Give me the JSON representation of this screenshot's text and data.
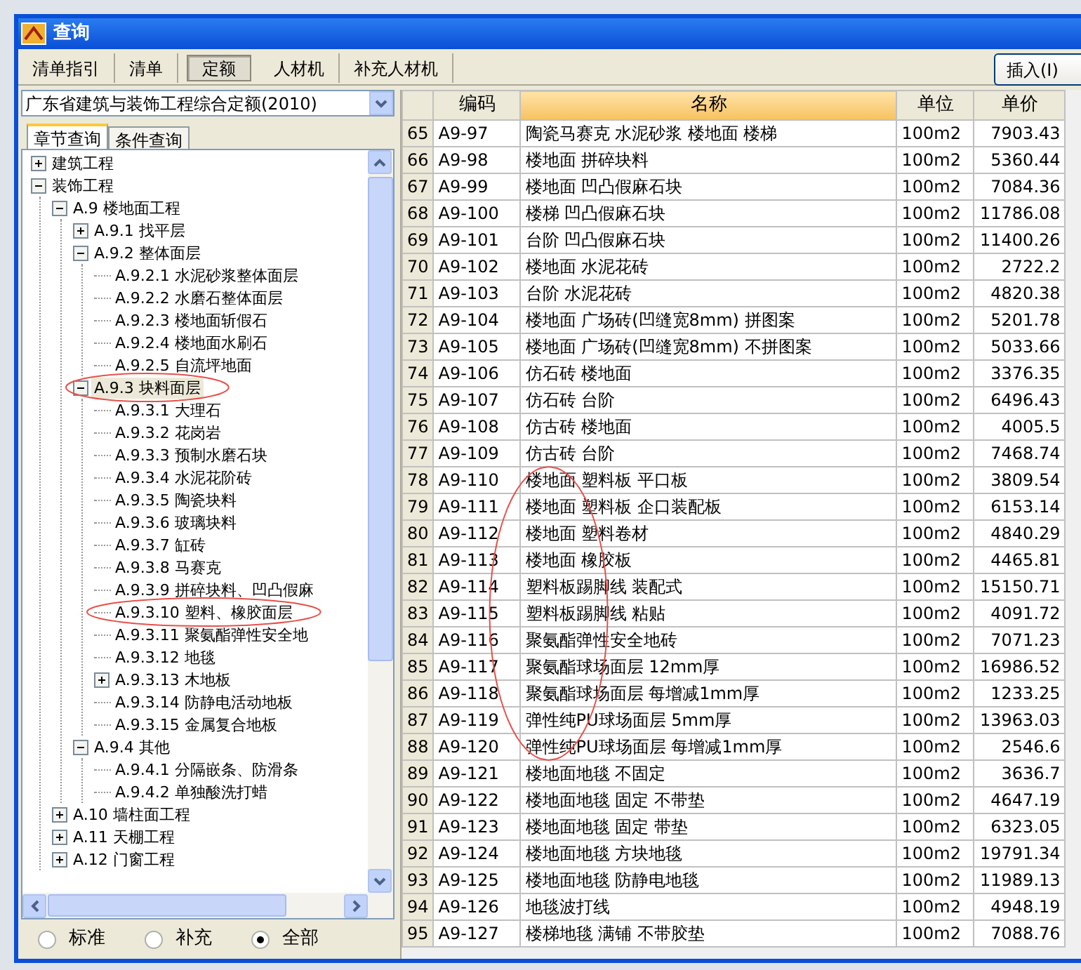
{
  "window": {
    "title": "查询"
  },
  "tabs": [
    {
      "label": "清单指引",
      "selected": false
    },
    {
      "label": "清单",
      "selected": false
    },
    {
      "label": "定额",
      "selected": true
    },
    {
      "label": "人材机",
      "selected": false
    },
    {
      "label": "补充人材机",
      "selected": false
    }
  ],
  "insert_button": "插入(I)",
  "quota_select": {
    "value": "广东省建筑与装饰工程综合定额(2010)"
  },
  "search_tabs": [
    {
      "label": "章节查询",
      "selected": true
    },
    {
      "label": "条件查询",
      "selected": false
    }
  ],
  "tree": [
    {
      "label": "建筑工程",
      "expanded": false,
      "selected": false
    },
    {
      "label": "装饰工程",
      "expanded": true,
      "selected": false,
      "children": [
        {
          "label": "A.9 楼地面工程",
          "expanded": true,
          "selected": false,
          "children": [
            {
              "label": "A.9.1 找平层",
              "expanded": false,
              "selected": false
            },
            {
              "label": "A.9.2 整体面层",
              "expanded": true,
              "selected": false,
              "children": [
                {
                  "label": "A.9.2.1 水泥砂浆整体面层",
                  "selected": false
                },
                {
                  "label": "A.9.2.2 水磨石整体面层",
                  "selected": false
                },
                {
                  "label": "A.9.2.3 楼地面斩假石",
                  "selected": false
                },
                {
                  "label": "A.9.2.4 楼地面水刷石",
                  "selected": false
                },
                {
                  "label": "A.9.2.5 自流坪地面",
                  "selected": false
                }
              ]
            },
            {
              "label": "A.9.3 块料面层",
              "expanded": true,
              "selected": true,
              "circled": true,
              "children": [
                {
                  "label": "A.9.3.1 大理石",
                  "selected": false
                },
                {
                  "label": "A.9.3.2 花岗岩",
                  "selected": false
                },
                {
                  "label": "A.9.3.3 预制水磨石块",
                  "selected": false
                },
                {
                  "label": "A.9.3.4 水泥花阶砖",
                  "selected": false
                },
                {
                  "label": "A.9.3.5 陶瓷块料",
                  "selected": false
                },
                {
                  "label": "A.9.3.6 玻璃块料",
                  "selected": false
                },
                {
                  "label": "A.9.3.7 缸砖",
                  "selected": false
                },
                {
                  "label": "A.9.3.8 马赛克",
                  "selected": false
                },
                {
                  "label": "A.9.3.9 拼碎块料、凹凸假麻",
                  "selected": false
                },
                {
                  "label": "A.9.3.10 塑料、橡胶面层",
                  "selected": false,
                  "circled": true
                },
                {
                  "label": "A.9.3.11 聚氨酯弹性安全地",
                  "selected": false
                },
                {
                  "label": "A.9.3.12 地毯",
                  "selected": false
                },
                {
                  "label": "A.9.3.13 木地板",
                  "expanded": false,
                  "selected": false
                },
                {
                  "label": "A.9.3.14 防静电活动地板",
                  "selected": false
                },
                {
                  "label": "A.9.3.15 金属复合地板",
                  "selected": false
                }
              ]
            },
            {
              "label": "A.9.4 其他",
              "expanded": true,
              "selected": false,
              "children": [
                {
                  "label": "A.9.4.1 分隔嵌条、防滑条",
                  "selected": false
                },
                {
                  "label": "A.9.4.2 单独酸洗打蜡",
                  "selected": false
                }
              ]
            }
          ]
        },
        {
          "label": "A.10 墙柱面工程",
          "expanded": false,
          "selected": false
        },
        {
          "label": "A.11 天棚工程",
          "expanded": false,
          "selected": false
        },
        {
          "label": "A.12 门窗工程",
          "expanded": false,
          "selected": false
        }
      ]
    }
  ],
  "filter_radios": [
    {
      "label": "标准",
      "selected": false
    },
    {
      "label": "补充",
      "selected": false
    },
    {
      "label": "全部",
      "selected": true
    }
  ],
  "table": {
    "columns": [
      {
        "label": "编码",
        "sorted": false
      },
      {
        "label": "名称",
        "sorted": true
      },
      {
        "label": "单位",
        "sorted": false
      },
      {
        "label": "单价",
        "sorted": false
      }
    ],
    "rows": [
      {
        "num": "65",
        "code": "A9-97",
        "name": "陶瓷马赛克 水泥砂浆 楼地面 楼梯",
        "unit": "100m2",
        "price": "7903.43"
      },
      {
        "num": "66",
        "code": "A9-98",
        "name": "楼地面 拼碎块料",
        "unit": "100m2",
        "price": "5360.44"
      },
      {
        "num": "67",
        "code": "A9-99",
        "name": "楼地面 凹凸假麻石块",
        "unit": "100m2",
        "price": "7084.36"
      },
      {
        "num": "68",
        "code": "A9-100",
        "name": "楼梯 凹凸假麻石块",
        "unit": "100m2",
        "price": "11786.08"
      },
      {
        "num": "69",
        "code": "A9-101",
        "name": "台阶 凹凸假麻石块",
        "unit": "100m2",
        "price": "11400.26"
      },
      {
        "num": "70",
        "code": "A9-102",
        "name": "楼地面 水泥花砖",
        "unit": "100m2",
        "price": "2722.2"
      },
      {
        "num": "71",
        "code": "A9-103",
        "name": "台阶 水泥花砖",
        "unit": "100m2",
        "price": "4820.38"
      },
      {
        "num": "72",
        "code": "A9-104",
        "name": "楼地面 广场砖(凹缝宽8mm) 拼图案",
        "unit": "100m2",
        "price": "5201.78"
      },
      {
        "num": "73",
        "code": "A9-105",
        "name": "楼地面 广场砖(凹缝宽8mm) 不拼图案",
        "unit": "100m2",
        "price": "5033.66"
      },
      {
        "num": "74",
        "code": "A9-106",
        "name": "仿石砖 楼地面",
        "unit": "100m2",
        "price": "3376.35"
      },
      {
        "num": "75",
        "code": "A9-107",
        "name": "仿石砖 台阶",
        "unit": "100m2",
        "price": "6496.43"
      },
      {
        "num": "76",
        "code": "A9-108",
        "name": "仿古砖 楼地面",
        "unit": "100m2",
        "price": "4005.5"
      },
      {
        "num": "77",
        "code": "A9-109",
        "name": "仿古砖 台阶",
        "unit": "100m2",
        "price": "7468.74"
      },
      {
        "num": "78",
        "code": "A9-110",
        "name": "楼地面 塑料板 平口板",
        "unit": "100m2",
        "price": "3809.54",
        "circled": true
      },
      {
        "num": "79",
        "code": "A9-111",
        "name": "楼地面 塑料板 企口装配板",
        "unit": "100m2",
        "price": "6153.14",
        "circled": true
      },
      {
        "num": "80",
        "code": "A9-112",
        "name": "楼地面 塑料卷材",
        "unit": "100m2",
        "price": "4840.29",
        "circled": true
      },
      {
        "num": "81",
        "code": "A9-113",
        "name": "楼地面 橡胶板",
        "unit": "100m2",
        "price": "4465.81",
        "circled": true
      },
      {
        "num": "82",
        "code": "A9-114",
        "name": "塑料板踢脚线 装配式",
        "unit": "100m2",
        "price": "15150.71",
        "circled": true
      },
      {
        "num": "83",
        "code": "A9-115",
        "name": "塑料板踢脚线 粘贴",
        "unit": "100m2",
        "price": "4091.72",
        "circled": true
      },
      {
        "num": "84",
        "code": "A9-116",
        "name": "聚氨酯弹性安全地砖",
        "unit": "100m2",
        "price": "7071.23",
        "circled": true
      },
      {
        "num": "85",
        "code": "A9-117",
        "name": "聚氨酯球场面层 12mm厚",
        "unit": "100m2",
        "price": "16986.52",
        "circled": true
      },
      {
        "num": "86",
        "code": "A9-118",
        "name": "聚氨酯球场面层 每增减1mm厚",
        "unit": "100m2",
        "price": "1233.25",
        "circled": true
      },
      {
        "num": "87",
        "code": "A9-119",
        "name": "弹性纯PU球场面层 5mm厚",
        "unit": "100m2",
        "price": "13963.03",
        "circled": true
      },
      {
        "num": "88",
        "code": "A9-120",
        "name": "弹性纯PU球场面层 每增减1mm厚",
        "unit": "100m2",
        "price": "2546.6",
        "circled": true
      },
      {
        "num": "89",
        "code": "A9-121",
        "name": "楼地面地毯 不固定",
        "unit": "100m2",
        "price": "3636.7"
      },
      {
        "num": "90",
        "code": "A9-122",
        "name": "楼地面地毯 固定 不带垫",
        "unit": "100m2",
        "price": "4647.19"
      },
      {
        "num": "91",
        "code": "A9-123",
        "name": "楼地面地毯 固定 带垫",
        "unit": "100m2",
        "price": "6323.05"
      },
      {
        "num": "92",
        "code": "A9-124",
        "name": "楼地面地毯 方块地毯",
        "unit": "100m2",
        "price": "19791.34"
      },
      {
        "num": "93",
        "code": "A9-125",
        "name": "楼地面地毯 防静电地毯",
        "unit": "100m2",
        "price": "11989.13"
      },
      {
        "num": "94",
        "code": "A9-126",
        "name": "地毯波打线",
        "unit": "100m2",
        "price": "4948.19"
      },
      {
        "num": "95",
        "code": "A9-127",
        "name": "楼梯地毯 满铺 不带胶垫",
        "unit": "100m2",
        "price": "7088.76"
      }
    ]
  }
}
